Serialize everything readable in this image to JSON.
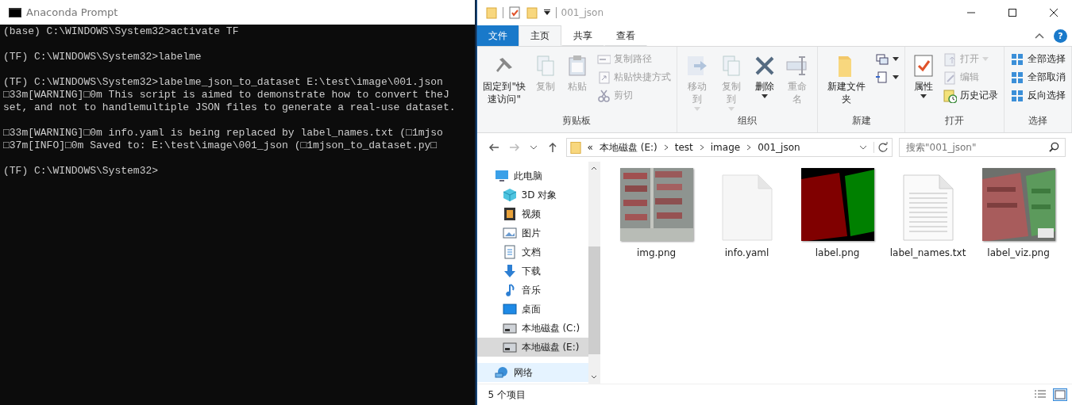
{
  "terminal": {
    "title": "Anaconda Prompt",
    "blocks": [
      [
        "(base) C:\\WINDOWS\\System32>activate TF"
      ],
      [
        "(TF) C:\\WINDOWS\\System32>labelme"
      ],
      [
        "(TF) C:\\WINDOWS\\System32>labelme_json_to_dataset E:\\test\\image\\001.json",
        "□33m[WARNING]□0m This script is aimed to demonstrate how to convert theJ",
        "set, and not to handlemultiple JSON files to generate a real-use dataset."
      ],
      [
        "□33m[WARNING]□0m info.yaml is being replaced by label_names.txt (□1mjso",
        "□37m[INFO]□0m Saved to: E:\\test\\image\\001_json (□1mjson_to_dataset.py□"
      ],
      [
        "(TF) C:\\WINDOWS\\System32>"
      ]
    ]
  },
  "explorer": {
    "title": "001_json",
    "tabs": [
      {
        "label": "文件",
        "kind": "file",
        "selected": false
      },
      {
        "label": "主页",
        "kind": "tab",
        "selected": true
      },
      {
        "label": "共享",
        "kind": "tab",
        "selected": false
      },
      {
        "label": "查看",
        "kind": "tab",
        "selected": false
      }
    ],
    "help": "?",
    "ribbon": [
      {
        "label": "剪贴板",
        "commands": [
          {
            "label": "固定到\"快速访问\"",
            "kind": "large",
            "disabled": false,
            "dropdown": false
          },
          {
            "label": "复制",
            "kind": "large",
            "disabled": true,
            "dropdown": false
          },
          {
            "label": "粘贴",
            "kind": "large",
            "disabled": true,
            "dropdown": false
          },
          {
            "label": "复制路径",
            "kind": "small",
            "disabled": true,
            "dropdown": false
          },
          {
            "label": "粘贴快捷方式",
            "kind": "small",
            "disabled": true,
            "dropdown": false
          },
          {
            "label": "剪切",
            "kind": "small",
            "disabled": true,
            "dropdown": false
          }
        ]
      },
      {
        "label": "组织",
        "commands": [
          {
            "label": "移动到",
            "kind": "large",
            "disabled": true,
            "dropdown": true
          },
          {
            "label": "复制到",
            "kind": "large",
            "disabled": true,
            "dropdown": true
          },
          {
            "label": "删除",
            "kind": "large",
            "disabled": false,
            "dropdown": true
          },
          {
            "label": "重命名",
            "kind": "large",
            "disabled": true,
            "dropdown": false
          }
        ]
      },
      {
        "label": "新建",
        "commands": [
          {
            "label": "新建文件夹",
            "kind": "large",
            "disabled": false,
            "dropdown": false
          },
          {
            "kind": "icon",
            "disabled": false,
            "dropdown": true
          },
          {
            "kind": "icon",
            "disabled": false,
            "dropdown": true
          }
        ]
      },
      {
        "label": "打开",
        "commands": [
          {
            "label": "属性",
            "kind": "large",
            "disabled": false,
            "dropdown": true
          },
          {
            "label": "打开",
            "kind": "small",
            "disabled": true,
            "dropdown": true
          },
          {
            "label": "编辑",
            "kind": "small",
            "disabled": true,
            "dropdown": false
          },
          {
            "label": "历史记录",
            "kind": "small",
            "disabled": false,
            "dropdown": false
          }
        ]
      },
      {
        "label": "选择",
        "commands": [
          {
            "label": "全部选择",
            "kind": "small",
            "disabled": false,
            "dropdown": false
          },
          {
            "label": "全部取消",
            "kind": "small",
            "disabled": false,
            "dropdown": false
          },
          {
            "label": "反向选择",
            "kind": "small",
            "disabled": false,
            "dropdown": false
          }
        ]
      }
    ],
    "address": {
      "overflow": "«",
      "crumbs": [
        "本地磁盘 (E:)",
        "test",
        "image",
        "001_json"
      ]
    },
    "search": {
      "placeholder": "搜索\"001_json\""
    },
    "nav": [
      {
        "label": "此电脑",
        "selected": false,
        "children": [
          {
            "label": "3D 对象",
            "selected": false
          },
          {
            "label": "视频",
            "selected": false
          },
          {
            "label": "图片",
            "selected": false
          },
          {
            "label": "文档",
            "selected": false
          },
          {
            "label": "下载",
            "selected": false
          },
          {
            "label": "音乐",
            "selected": false
          },
          {
            "label": "桌面",
            "selected": false
          },
          {
            "label": "本地磁盘 (C:)",
            "selected": false
          },
          {
            "label": "本地磁盘 (E:)",
            "selected": true
          }
        ]
      },
      {
        "label": "网络",
        "selected": false,
        "hovered": true
      }
    ],
    "files": [
      {
        "name": "img.png",
        "kind": "picture"
      },
      {
        "name": "info.yaml",
        "kind": "file"
      },
      {
        "name": "label.png",
        "kind": "picture"
      },
      {
        "name": "label_names.txt",
        "kind": "text"
      },
      {
        "name": "label_viz.png",
        "kind": "picture"
      }
    ],
    "status": "5 个项目"
  }
}
